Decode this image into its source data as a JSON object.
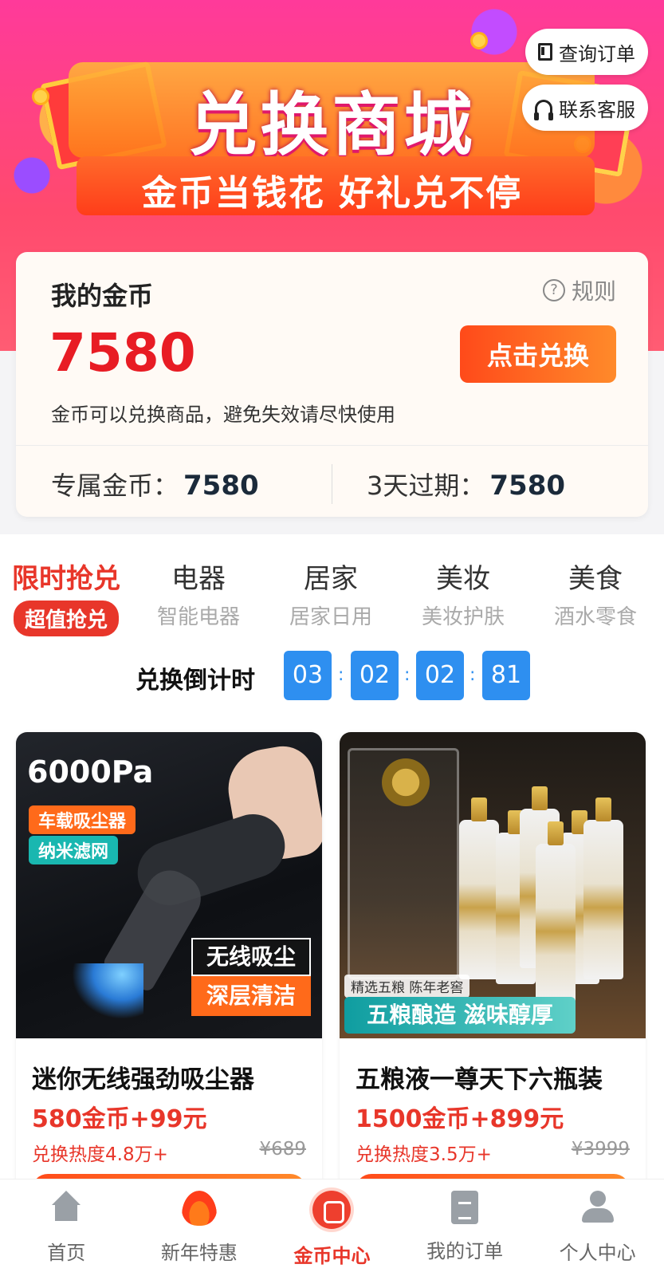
{
  "header": {
    "title": "兑换商城",
    "subtitle": "金币当钱花 好礼兑不停",
    "query_orders": "查询订单",
    "contact_service": "联系客服"
  },
  "coins": {
    "title": "我的金币",
    "rules": "规则",
    "balance": "7580",
    "redeem_button": "点击兑换",
    "note": "金币可以兑换商品，避免失效请尽快使用",
    "exclusive_label": "专属金币：",
    "exclusive_value": "7580",
    "expiring_label": "3天过期：",
    "expiring_value": "7580"
  },
  "categories": [
    {
      "title": "限时抢兑",
      "sub": "超值抢兑",
      "active": true
    },
    {
      "title": "电器",
      "sub": "智能电器"
    },
    {
      "title": "居家",
      "sub": "居家日用"
    },
    {
      "title": "美妆",
      "sub": "美妆护肤"
    },
    {
      "title": "美食",
      "sub": "酒水零食"
    }
  ],
  "countdown": {
    "label": "兑换倒计时",
    "values": [
      "03",
      "02",
      "02",
      "81"
    ],
    "separator": ":"
  },
  "products": [
    {
      "name": "迷你无线强劲吸尘器",
      "price": "580金币+99元",
      "heat": "兑换热度4.8万+",
      "original_price": "¥689",
      "image_text": {
        "power": "6000Pa",
        "tag1": "车载吸尘器",
        "tag2": "纳米滤网",
        "line1": "无线吸尘",
        "line2": "深层清洁"
      }
    },
    {
      "name": "五粮液一尊天下六瓶装",
      "price": "1500金币+899元",
      "heat": "兑换热度3.5万+",
      "original_price": "¥3999",
      "image_text": {
        "tag": "精选五粮 陈年老窖",
        "banner": "五粮酿造 滋味醇厚"
      }
    }
  ],
  "nav": [
    {
      "label": "首页",
      "icon": "home-icon"
    },
    {
      "label": "新年特惠",
      "icon": "fire-icon"
    },
    {
      "label": "金币中心",
      "icon": "coin-center-icon",
      "active": true
    },
    {
      "label": "我的订单",
      "icon": "clipboard-icon"
    },
    {
      "label": "个人中心",
      "icon": "user-icon"
    }
  ],
  "colors": {
    "accent": "#e8362a",
    "countdown_box": "#2e8ff0",
    "banner_pink": "#ff2f8a",
    "button_orange": "#ff6a1a"
  }
}
